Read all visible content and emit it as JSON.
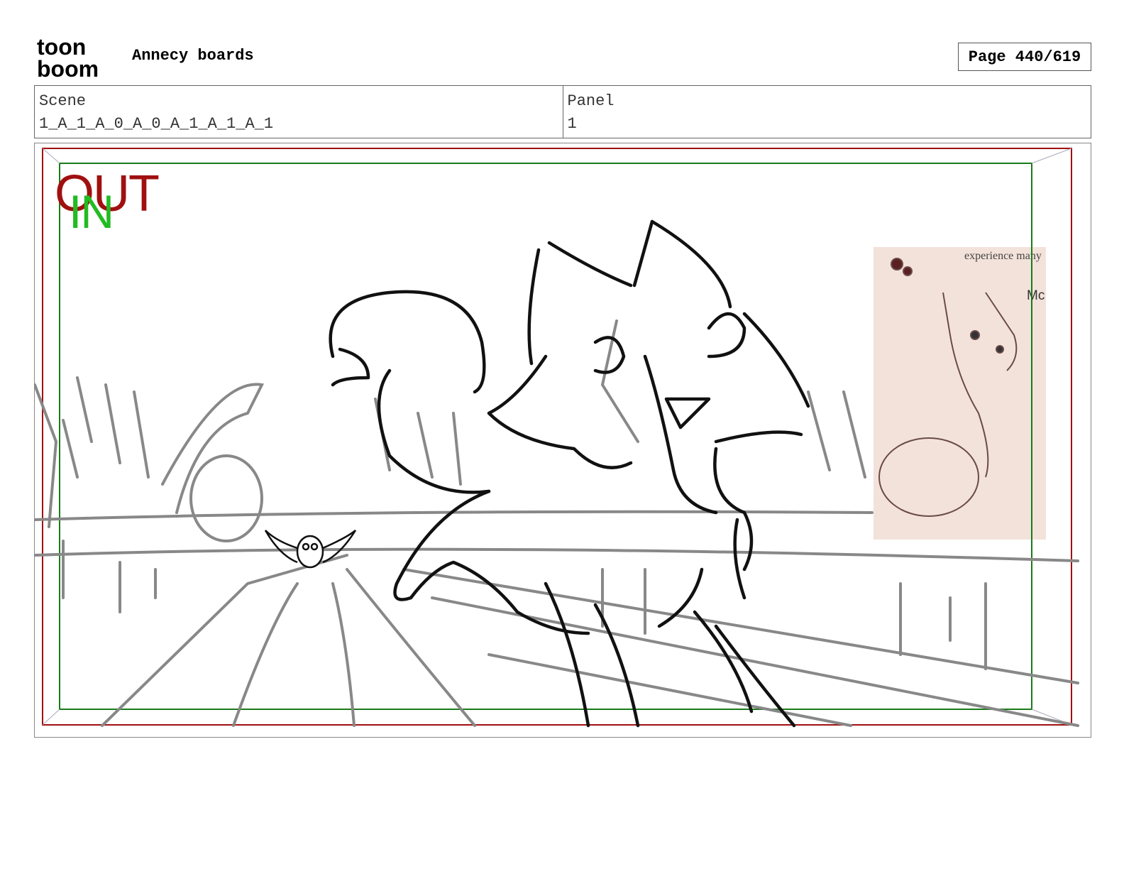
{
  "header": {
    "logo_text_top": "toon",
    "logo_text_bottom": "boom",
    "title": "Annecy boards",
    "page_label": "Page 440/619"
  },
  "info": {
    "scene_label": "Scene",
    "scene_value": "1_A_1_A_0_A_0_A_1_A_1_A_1",
    "panel_label": "Panel",
    "panel_value": "1"
  },
  "panel": {
    "out_label": "OUT",
    "in_label": "IN",
    "reference_text_1": "experience many",
    "reference_text_2": "Mc",
    "colors": {
      "out_frame": "#a01010",
      "in_frame": "#1a7a1a",
      "sketch_gray": "#888888",
      "sketch_black": "#111111",
      "reference_bg": "#f3e2da"
    }
  }
}
